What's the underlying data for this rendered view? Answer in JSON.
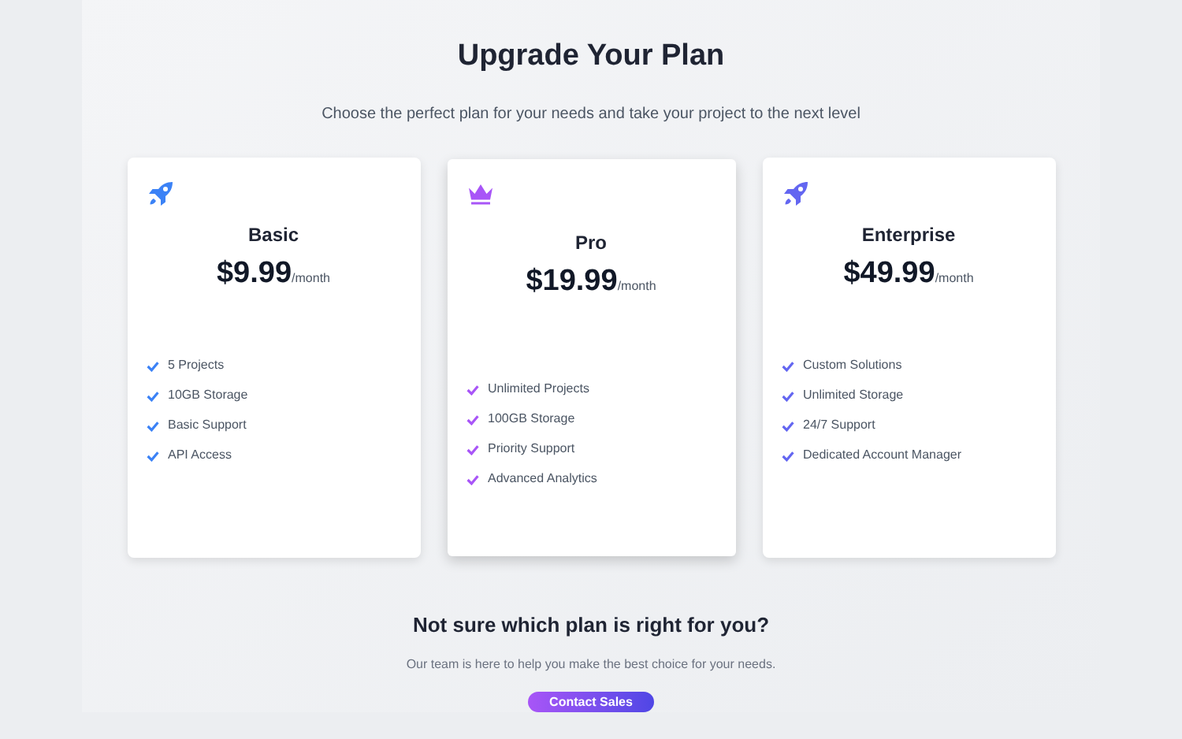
{
  "title": "Upgrade Your Plan",
  "subtitle": "Choose the perfect plan for your needs and take your project to the next level",
  "plans": [
    {
      "name": "Basic",
      "price": "$9.99",
      "period": "/month",
      "kind": "rocket",
      "color": "#3b82f6",
      "featured": false,
      "features": [
        "5 Projects",
        "10GB Storage",
        "Basic Support",
        "API Access"
      ]
    },
    {
      "name": "Pro",
      "price": "$19.99",
      "period": "/month",
      "kind": "crown",
      "color": "#a855f7",
      "featured": true,
      "features": [
        "Unlimited Projects",
        "100GB Storage",
        "Priority Support",
        "Advanced Analytics"
      ]
    },
    {
      "name": "Enterprise",
      "price": "$49.99",
      "period": "/month",
      "kind": "rocket",
      "color": "#6366f1",
      "featured": false,
      "features": [
        "Custom Solutions",
        "Unlimited Storage",
        "24/7 Support",
        "Dedicated Account Manager"
      ]
    }
  ],
  "help": {
    "title": "Not sure which plan is right for you?",
    "text": "Our team is here to help you make the best choice for your needs.",
    "button": "Contact Sales"
  }
}
